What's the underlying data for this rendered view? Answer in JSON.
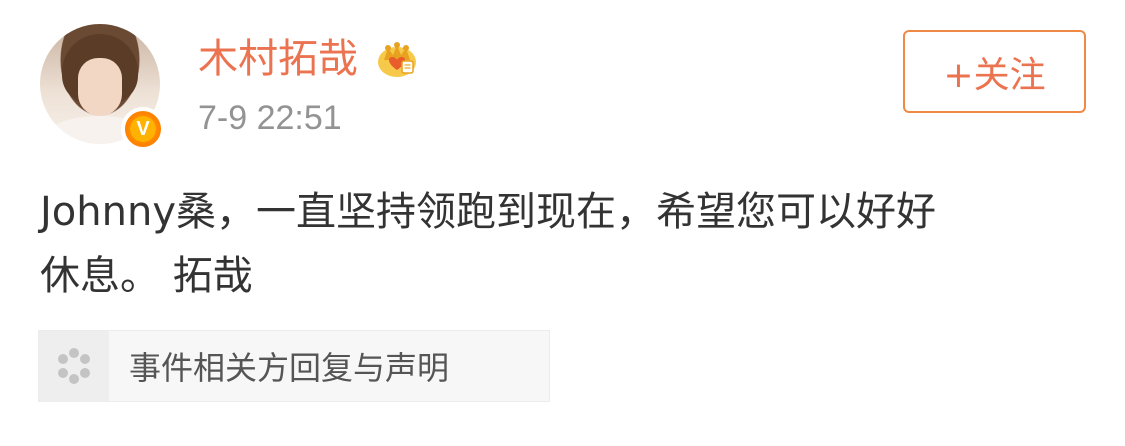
{
  "post": {
    "username": "木村拓哉",
    "timestamp": "7-9 22:51",
    "follow_label": "+关注",
    "content_line1": "Johnny桑，一直坚持领跑到现在，希望您可以好好",
    "content_line2": "休息。 拓哉",
    "verified_badge_letter": "V",
    "event_card_label": "事件相关方回复与声明"
  },
  "colors": {
    "username": "#eb7350",
    "follow_border": "#ef8a46",
    "timestamp": "#939393",
    "content_text": "#333333",
    "verified_badge": "#ff8200"
  },
  "icons": {
    "avatar": "avatar",
    "verified": "verified-v-icon",
    "member_crown": "crown-icon",
    "event": "loading-dots-icon"
  }
}
